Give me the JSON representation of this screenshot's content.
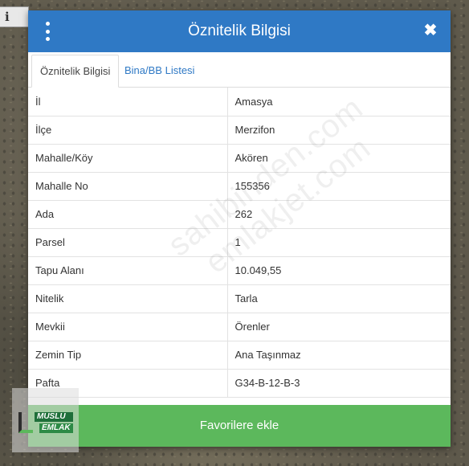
{
  "info_tab": {
    "label": "i"
  },
  "modal": {
    "title": "Öznitelik Bilgisi",
    "menu_icon": "kebab-menu-icon",
    "close_icon": "close-icon",
    "close_label": "✖"
  },
  "tabs": [
    {
      "label": "Öznitelik Bilgisi",
      "active": true
    },
    {
      "label": "Bina/BB Listesi",
      "active": false
    }
  ],
  "attributes": [
    {
      "key": "İl",
      "value": "Amasya"
    },
    {
      "key": "İlçe",
      "value": "Merzifon"
    },
    {
      "key": "Mahalle/Köy",
      "value": "Akören"
    },
    {
      "key": "Mahalle No",
      "value": "155356"
    },
    {
      "key": "Ada",
      "value": "262"
    },
    {
      "key": "Parsel",
      "value": "1"
    },
    {
      "key": "Tapu Alanı",
      "value": "10.049,55"
    },
    {
      "key": "Nitelik",
      "value": "Tarla"
    },
    {
      "key": "Mevkii",
      "value": "Örenler"
    },
    {
      "key": "Zemin Tip",
      "value": "Ana Taşınmaz"
    },
    {
      "key": "Pafta",
      "value": "G34-B-12-B-3"
    }
  ],
  "footer": {
    "button_label": "Favorilere ekle"
  },
  "watermark": "sahibinden.com emlakjet.com",
  "logo": {
    "line1": "MUSLU",
    "line2": "EMLAK"
  },
  "colors": {
    "header": "#2f79c5",
    "button": "#5cb85c",
    "link": "#2f79c5"
  }
}
